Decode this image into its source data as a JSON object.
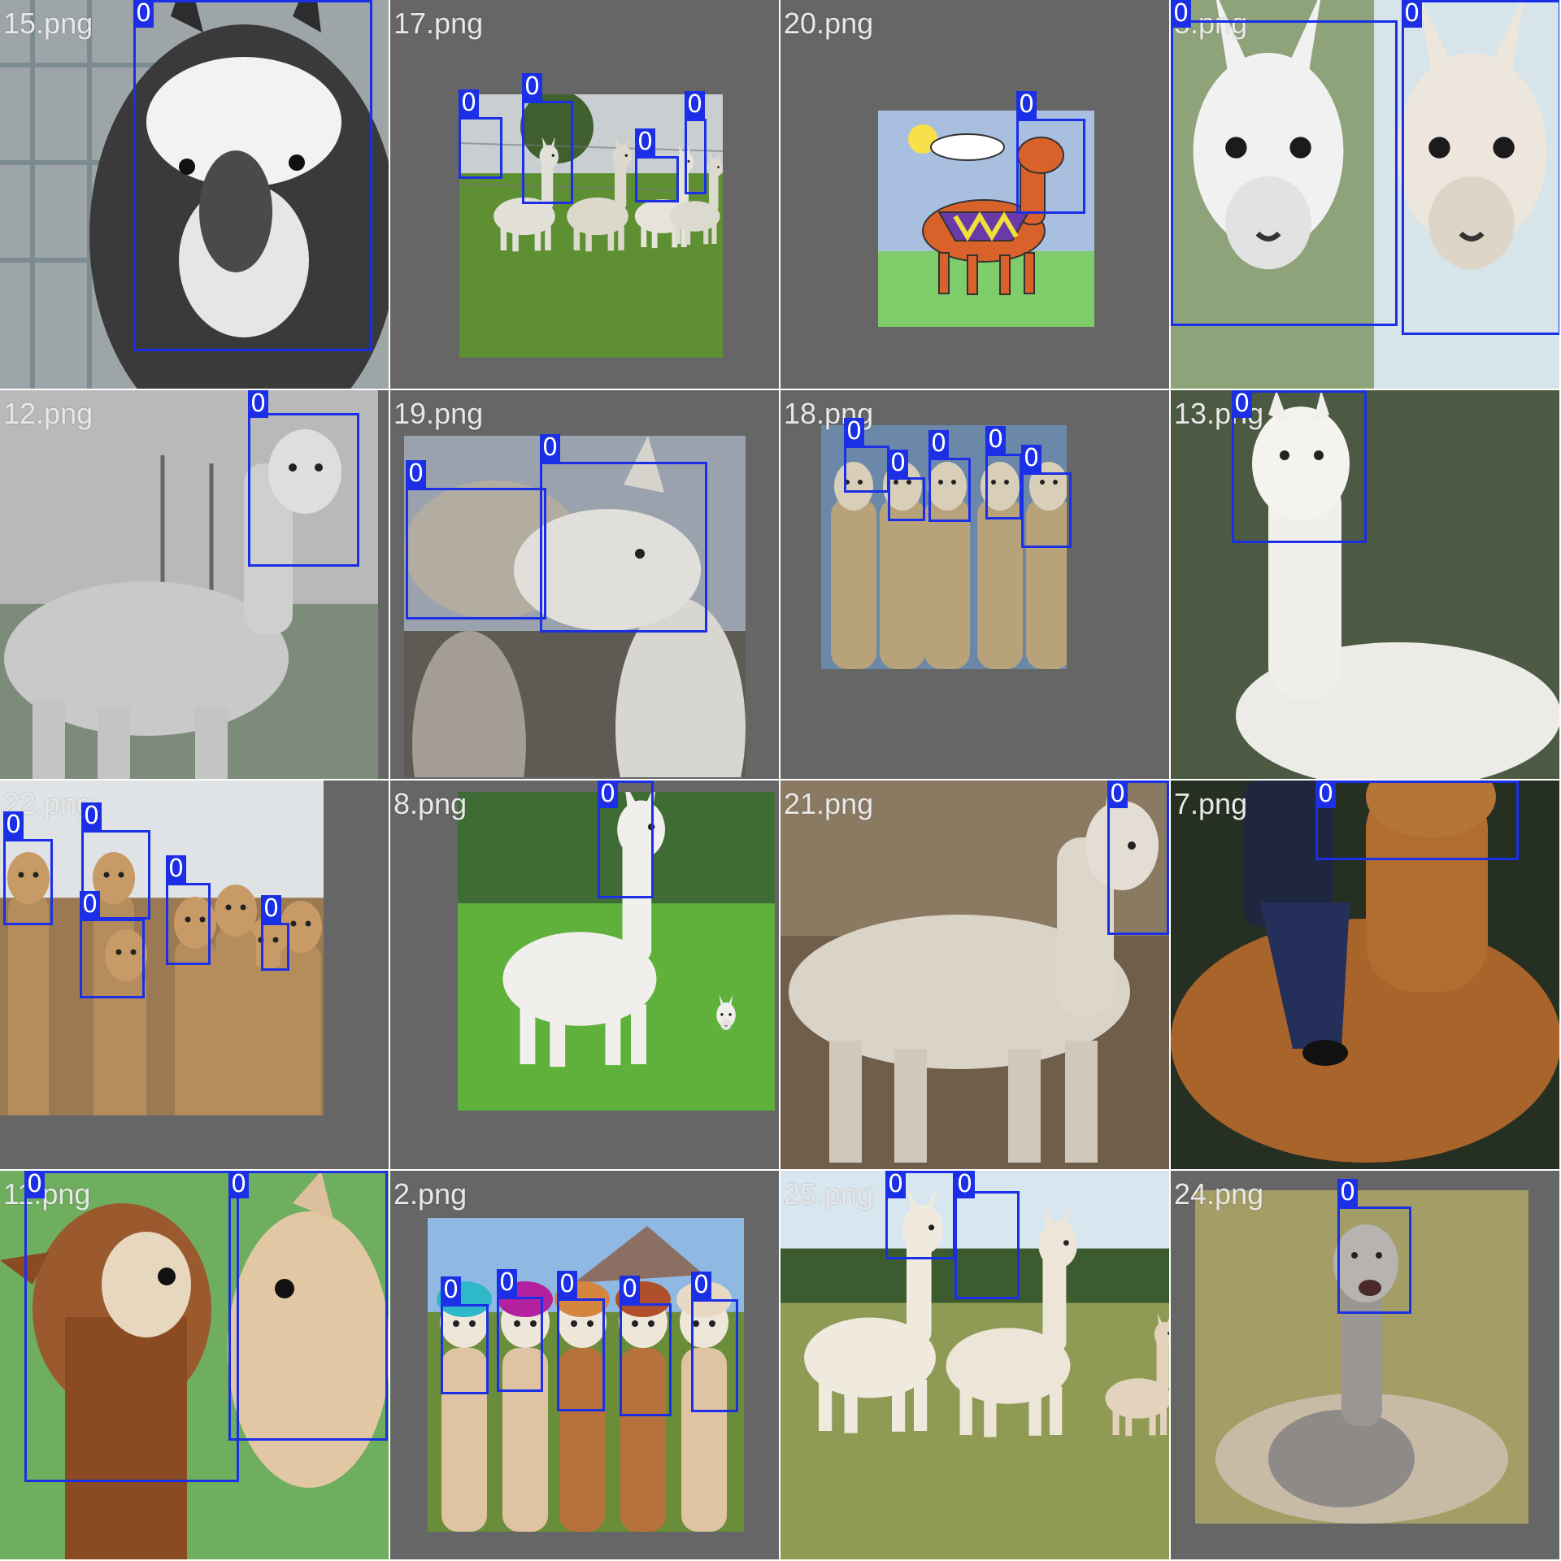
{
  "colors": {
    "box": "#1a2fe6",
    "label_text": "#ffffff",
    "filename_text": "#e8e8e8",
    "pad_gray": "#666666"
  },
  "class_label": "0",
  "tiles": [
    {
      "file": "15.png",
      "scene": "llama-closeup-dark"
    },
    {
      "file": "17.png",
      "scene": "alpacas-fence-field"
    },
    {
      "file": "20.png",
      "scene": "cartoon-llama-drawing"
    },
    {
      "file": "5.png",
      "scene": "two-llama-faces"
    },
    {
      "file": "12.png",
      "scene": "gray-alpaca-side"
    },
    {
      "file": "19.png",
      "scene": "two-llamas-kissing"
    },
    {
      "file": "18.png",
      "scene": "five-alpacas-sky"
    },
    {
      "file": "13.png",
      "scene": "white-alpaca-resting"
    },
    {
      "file": "22.png",
      "scene": "alpaca-herd-brown"
    },
    {
      "file": "8.png",
      "scene": "white-alpaca-grass"
    },
    {
      "file": "21.png",
      "scene": "beige-alpaca-walking"
    },
    {
      "file": "7.png",
      "scene": "person-on-alpaca"
    },
    {
      "file": "11.png",
      "scene": "two-alpaca-faces"
    },
    {
      "file": "2.png",
      "scene": "colorful-hair-alpacas"
    },
    {
      "file": "25.png",
      "scene": "white-llamas-farm"
    },
    {
      "file": "24.png",
      "scene": "gray-alpaca-sitting"
    }
  ]
}
